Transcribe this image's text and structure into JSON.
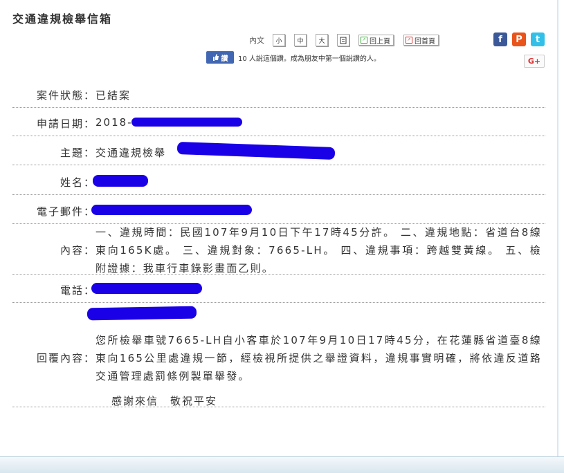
{
  "page_title": "交通違規檢舉信箱",
  "toolbar": {
    "label": "內文",
    "sizes": [
      "小",
      "中",
      "大"
    ],
    "print_icon": "print-icon",
    "back_label": "回上頁",
    "home_label": "回首頁"
  },
  "social": {
    "facebook": "f",
    "plurk": "P",
    "twitter": "t",
    "gplus": "G+",
    "like_label": "讚",
    "like_text": "10 人說這個讚。成為朋友中第一個說讚的人。"
  },
  "form": {
    "status_label": "案件狀態：",
    "status_value": "已結案",
    "date_label": "申請日期：",
    "date_value": "2018-",
    "subject_label": "主題：",
    "subject_value": "交通違規檢舉",
    "name_label": "姓名：",
    "email_label": "電子郵件：",
    "content_label": "內容：",
    "content_value": "一、違規時間：民國107年9月10日下午17時45分許。 二、違規地點：省道台8線東向165K處。 三、違規對象：7665-LH。 四、違規事項：跨越雙黃線。 五、檢附證據：我車行車錄影畫面乙則。",
    "phone_label": "電話：",
    "reply_label": "回覆內容：",
    "reply_value": "您所檢舉車號7665-LH自小客車於107年9月10日17時45分，在花蓮縣省道臺8線東向165公里處違規一節，經檢視所提供之舉證資料，違規事實明確，將依違反道路交通管理處罰條例製單舉發。",
    "closing": "感謝來信　敬祝平安"
  }
}
